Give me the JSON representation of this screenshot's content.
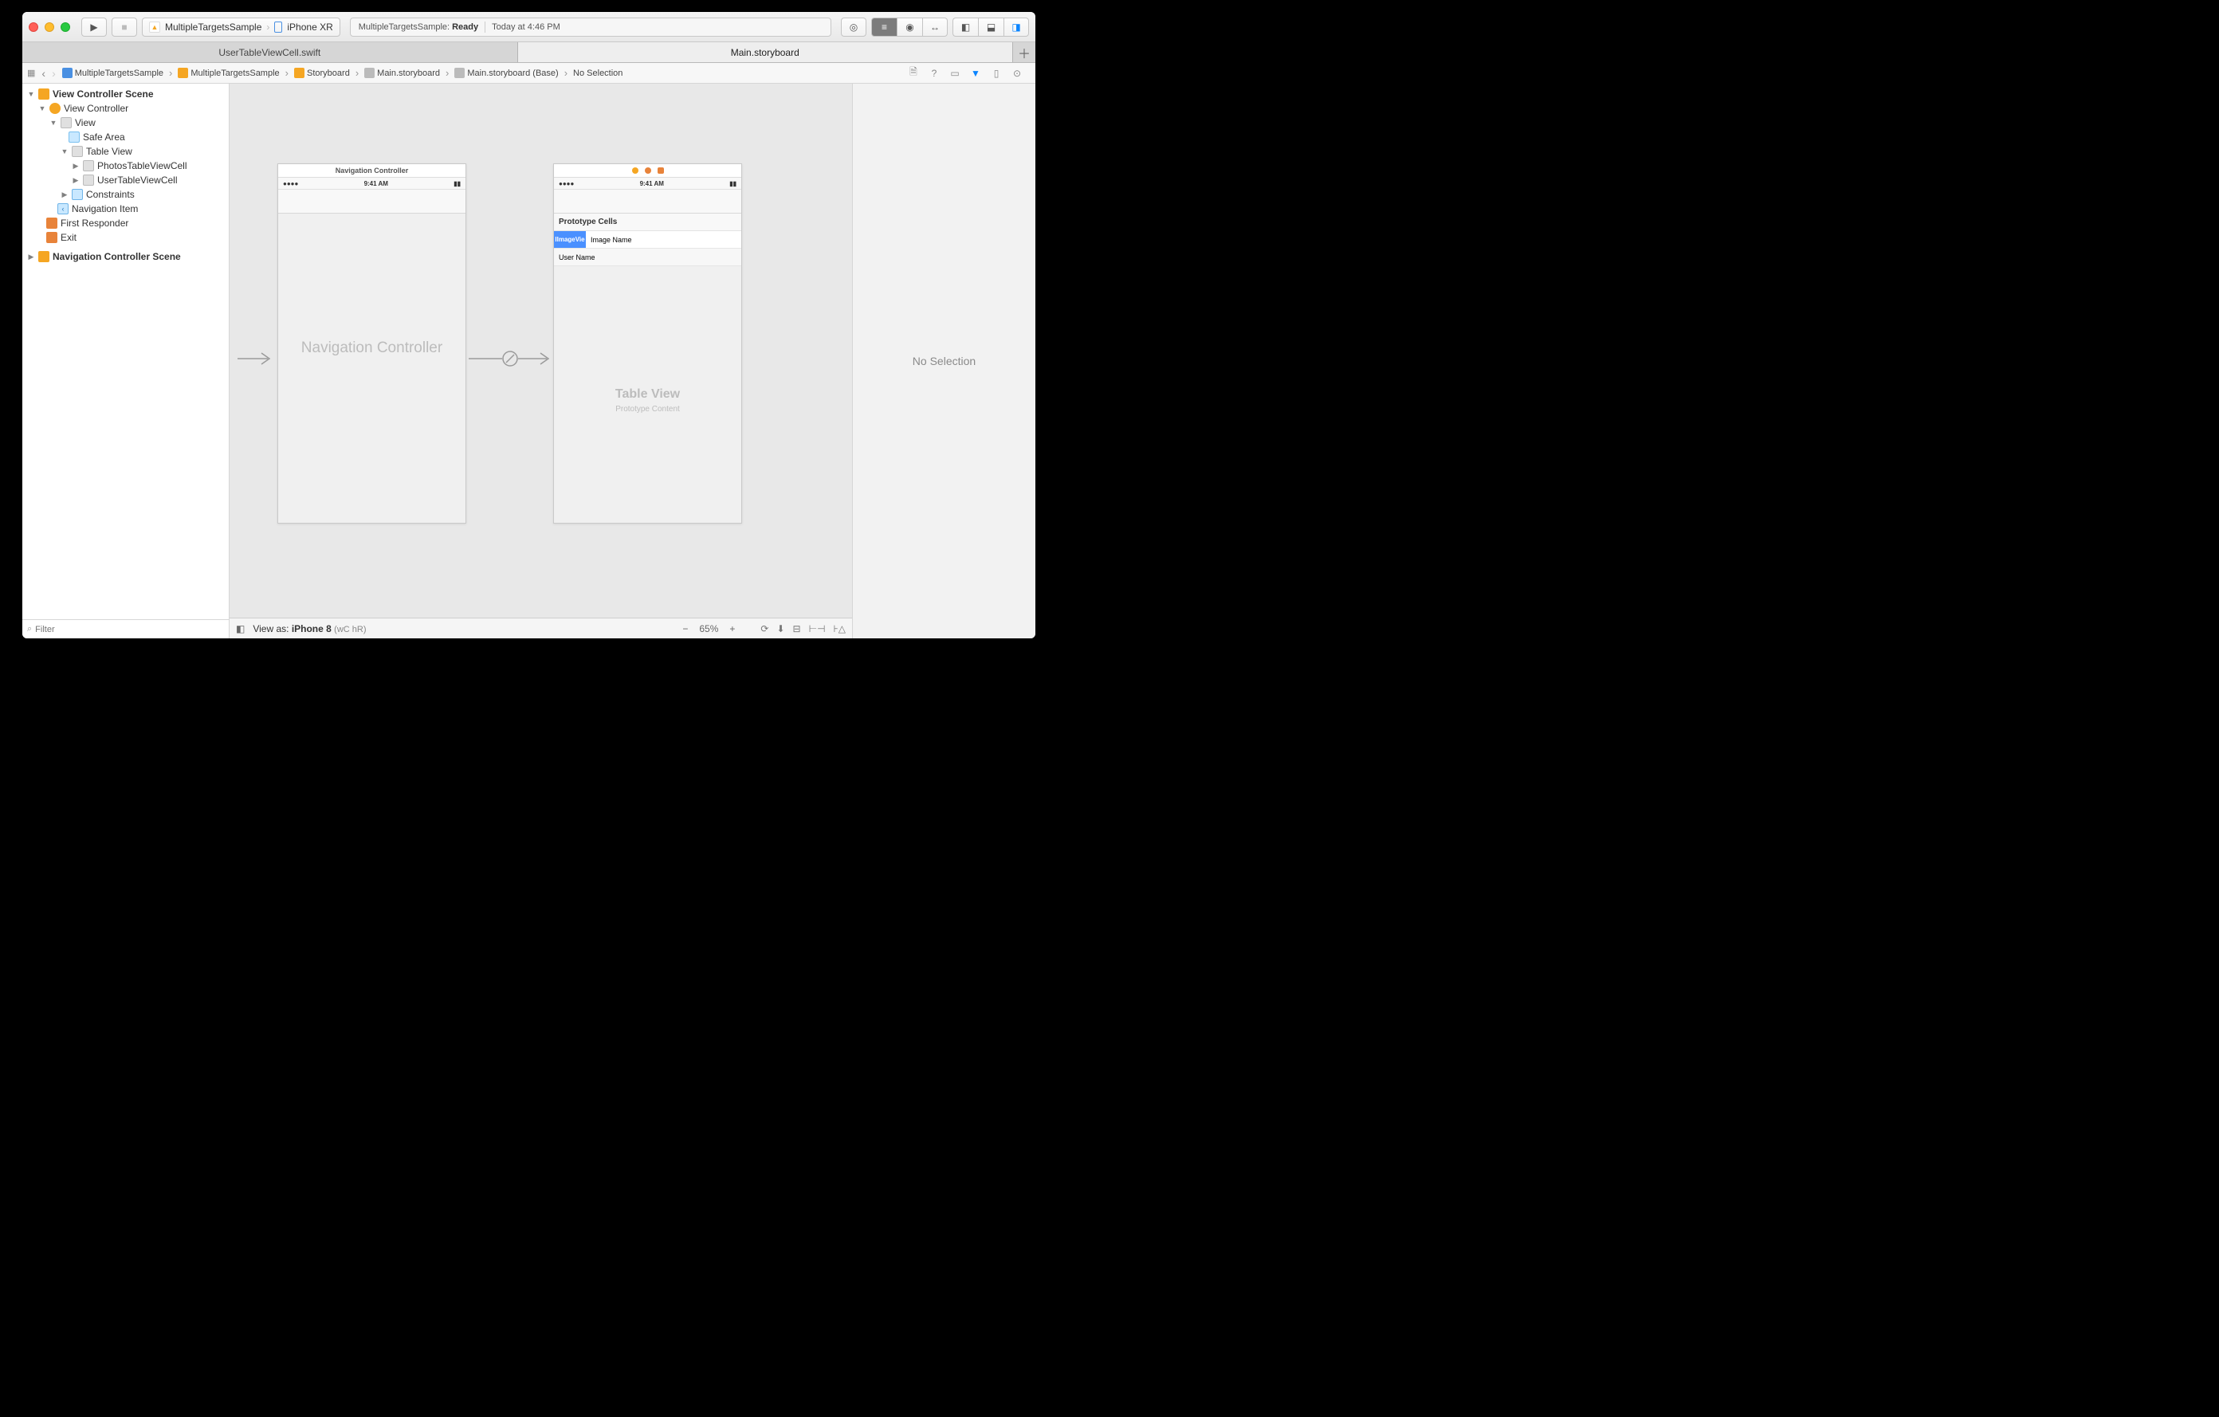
{
  "toolbar": {
    "scheme_target": "MultipleTargetsSample",
    "scheme_device": "iPhone XR",
    "activity_project": "MultipleTargetsSample:",
    "activity_status": "Ready",
    "activity_time": "Today at 4:46 PM"
  },
  "tabs": {
    "t1": "UserTableViewCell.swift",
    "t2": "Main.storyboard"
  },
  "jumpbar": {
    "c1": "MultipleTargetsSample",
    "c2": "MultipleTargetsSample",
    "c3": "Storyboard",
    "c4": "Main.storyboard",
    "c5": "Main.storyboard (Base)",
    "c6": "No Selection"
  },
  "outline": {
    "scene1": "View Controller Scene",
    "vc": "View Controller",
    "view": "View",
    "safearea": "Safe Area",
    "tableview": "Table View",
    "cell1": "PhotosTableViewCell",
    "cell2": "UserTableViewCell",
    "constraints": "Constraints",
    "navitem": "Navigation Item",
    "firstresp": "First Responder",
    "exit": "Exit",
    "scene2": "Navigation Controller Scene",
    "filter_placeholder": "Filter"
  },
  "canvas": {
    "nav_title": "Navigation Controller",
    "status_time": "9:41 AM",
    "nav_placeholder": "Navigation Controller",
    "proto_header": "Prototype Cells",
    "imageview_label": "IImageVie",
    "image_name": "Image Name",
    "user_name": "User Name",
    "tableview_big": "Table View",
    "tableview_sub": "Prototype Content"
  },
  "canvasbar": {
    "viewas_prefix": "View as: ",
    "viewas_device": "iPhone 8",
    "sizeclass": "(wC hR)",
    "zoom": "65%"
  },
  "inspector": {
    "empty": "No Selection"
  }
}
